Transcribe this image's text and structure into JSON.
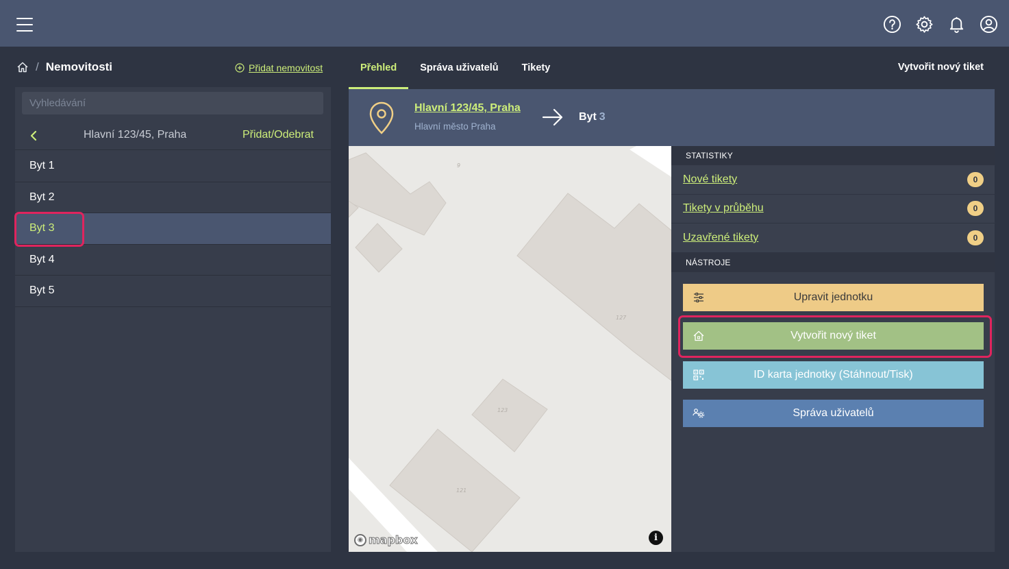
{
  "topbar": {
    "icons": [
      "menu-icon",
      "help-icon",
      "gear-icon",
      "bell-icon",
      "user-icon"
    ]
  },
  "breadcrumb": {
    "separator": "/",
    "title": "Nemovitosti",
    "add_label": "Přidat nemovitost"
  },
  "sidebar": {
    "search_placeholder": "Vyhledávání",
    "address": "Hlavní 123/45, Praha",
    "add_remove_label": "Přidat/Odebrat",
    "units": [
      {
        "label": "Byt 1",
        "active": false
      },
      {
        "label": "Byt 2",
        "active": false
      },
      {
        "label": "Byt 3",
        "active": true
      },
      {
        "label": "Byt 4",
        "active": false
      },
      {
        "label": "Byt 5",
        "active": false
      }
    ]
  },
  "tabs": {
    "items": [
      {
        "label": "Přehled",
        "active": true
      },
      {
        "label": "Správa uživatelů",
        "active": false
      },
      {
        "label": "Tikety",
        "active": false
      }
    ],
    "right_action": "Vytvořit nový tiket"
  },
  "header": {
    "address_link": "Hlavní 123/45, Praha",
    "address_sub": "Hlavní město Praha",
    "unit_prefix": "Byt",
    "unit_number": "3"
  },
  "map": {
    "labels": [
      "9",
      "127",
      "123",
      "121"
    ],
    "attribution": "mapbox",
    "info": "i"
  },
  "stats": {
    "title": "STATISTIKY",
    "rows": [
      {
        "label": "Nové tikety",
        "count": "0"
      },
      {
        "label": "Tikety v průběhu",
        "count": "0"
      },
      {
        "label": "Uzavřené tikety",
        "count": "0"
      }
    ]
  },
  "tools": {
    "title": "NÁSTROJE",
    "buttons": [
      {
        "label": "Upravit jednotku",
        "icon": "sliders-icon",
        "color": "#eecb87"
      },
      {
        "label": "Vytvořit nový tiket",
        "icon": "house-icon",
        "color": "#a2c185"
      },
      {
        "label": "ID karta jednotky (Stáhnout/Tisk)",
        "icon": "qr-code-icon",
        "color": "#87c4d6"
      },
      {
        "label": "Správa uživatelů",
        "icon": "users-gear-icon",
        "color": "#5b80b0"
      }
    ]
  },
  "colors": {
    "accent": "#cdee7a",
    "highlight": "#e0245e",
    "topbar": "#4a5670",
    "badge": "#f0cf86"
  }
}
